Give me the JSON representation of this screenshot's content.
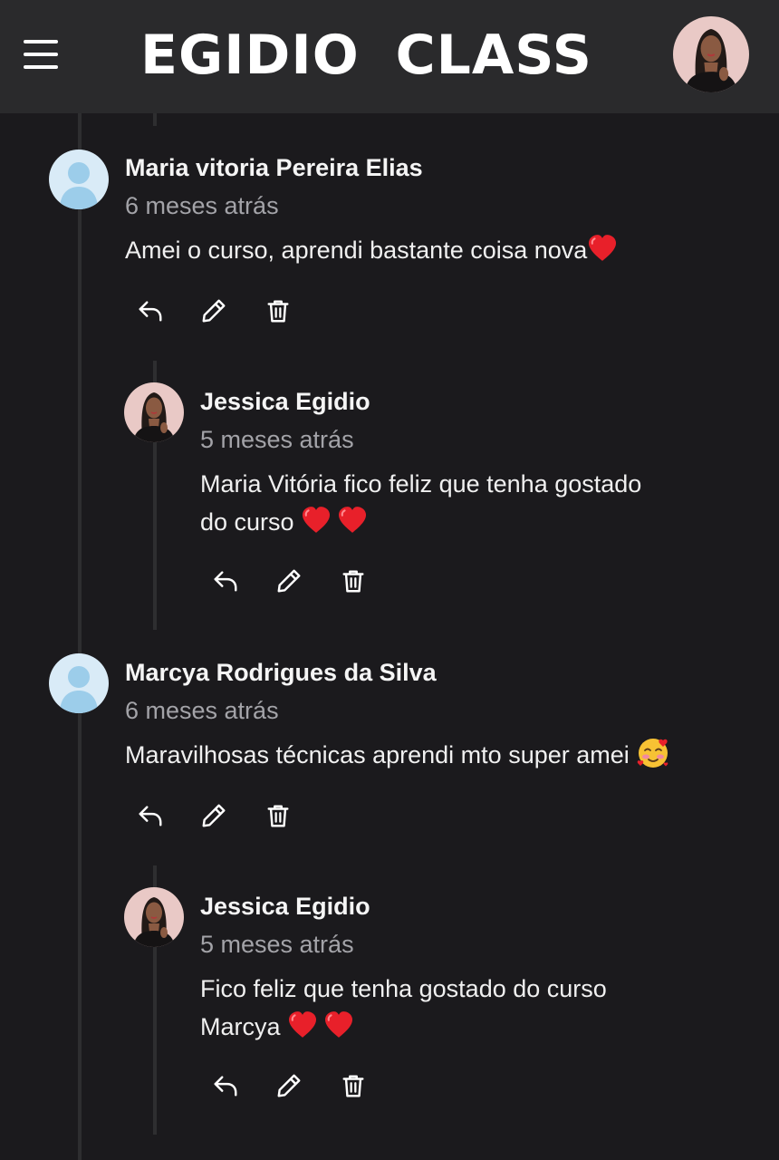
{
  "header": {
    "brand_title": "EGIDIO  CLASS",
    "menu_icon": "hamburger-menu-icon",
    "profile_avatar": "user-profile-avatar"
  },
  "comments": [
    {
      "author": "Maria vitoria Pereira Elias",
      "time": "6 meses atrás",
      "text": "Amei o curso, aprendi bastante coisa nova",
      "avatar": "default-user-silhouette",
      "reply": {
        "author": "Jessica Egidio",
        "time": "5 meses atrás",
        "text_line1": "Maria Vitória fico feliz que tenha gostado",
        "text_line2": "do curso "
      }
    },
    {
      "author": "Marcya Rodrigues da Silva",
      "time": "6 meses atrás",
      "text": "Maravilhosas técnicas aprendi mto super amei ",
      "avatar": "default-user-silhouette",
      "reply": {
        "author": "Jessica Egidio",
        "time": "5 meses atrás",
        "text_line1": "Fico feliz que tenha gostado do curso",
        "text_line2": "Marcya "
      }
    }
  ],
  "actions": {
    "reply_icon": "reply-icon",
    "edit_icon": "pencil-icon",
    "delete_icon": "trash-icon"
  },
  "colors": {
    "background": "#1b1a1d",
    "header": "#2a2a2c",
    "thread_line": "#2e2e30",
    "muted_text": "#a3a3a8",
    "heart": "#e8202a"
  }
}
